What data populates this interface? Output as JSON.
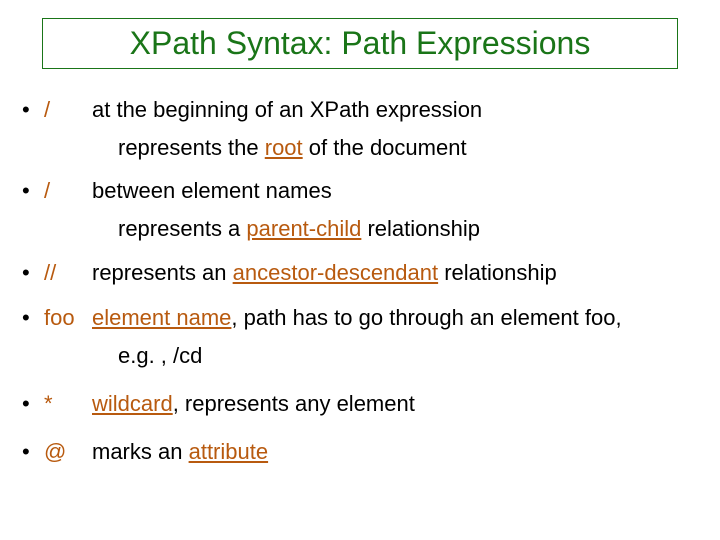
{
  "title": "XPath Syntax: Path Expressions",
  "bullets": [
    {
      "symbol": "/",
      "text": "at the beginning of an XPath expression",
      "sub_pre": "represents the ",
      "sub_key": "root",
      "sub_post": " of the document"
    },
    {
      "symbol": "/",
      "text": "between element names",
      "sub_pre": "represents a ",
      "sub_key": "parent-child",
      "sub_post": " relationship"
    },
    {
      "symbol": "//",
      "text_pre": "represents an ",
      "text_key": "ancestor-descendant",
      "text_post": " relationship"
    },
    {
      "symbol": "foo",
      "text_pre": "",
      "text_key": "element name",
      "text_post": ", path has to go through an element foo,",
      "sub_plain": "e.g. , /cd"
    },
    {
      "symbol": "*",
      "text_pre": "",
      "text_key": "wildcard",
      "text_post": ", represents any element"
    },
    {
      "symbol": "@",
      "text_pre": "marks an ",
      "text_key": "attribute",
      "text_post": ""
    }
  ]
}
